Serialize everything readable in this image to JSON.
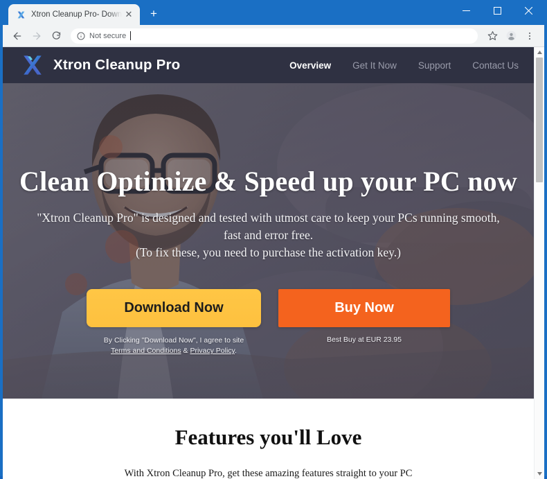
{
  "browser": {
    "tab": {
      "title": "Xtron Cleanup Pro- Download P",
      "favicon_name": "xtron-favicon",
      "close_label": "✕"
    },
    "newtab_label": "+",
    "window_controls": {
      "minimize": "minimize-button",
      "maximize": "maximize-button",
      "close": "close-button"
    },
    "toolbar": {
      "back": "back-button",
      "forward": "forward-button",
      "reload": "reload-button",
      "security_label": "Not secure",
      "url_value": "",
      "url_placeholder": "",
      "bookmark": "bookmark-star-button",
      "profile": "profile-button",
      "menu": "chrome-menu-button"
    }
  },
  "site": {
    "brand": "Xtron Cleanup Pro",
    "nav": [
      {
        "label": "Overview",
        "active": true
      },
      {
        "label": "Get It Now",
        "active": false
      },
      {
        "label": "Support",
        "active": false
      },
      {
        "label": "Contact Us",
        "active": false
      }
    ],
    "hero": {
      "title": "Clean Optimize & Speed up your PC now",
      "sub_line1": "\"Xtron Cleanup Pro\" is designed and tested with utmost care to keep your PCs running smooth,",
      "sub_line2": "fast and error free.",
      "sub_line3": "(To fix these, you need to purchase the activation key.)",
      "download_button": "Download Now",
      "buy_button": "Buy Now",
      "download_note_prefix": "By Clicking \"Download Now\", I agree to site",
      "terms_link": "Terms and Conditions",
      "note_amp": "&",
      "privacy_link": "Privacy Policy",
      "note_period": ".",
      "buy_note": "Best Buy at EUR 23.95"
    },
    "features": {
      "title": "Features you'll Love",
      "subtitle": "With Xtron Cleanup Pro, get these amazing features straight to your PC"
    }
  },
  "colors": {
    "window_frame": "#1a6fc4",
    "site_header": "#2f3142",
    "download_button": "#fdc13f",
    "buy_button": "#f4631e",
    "nav_active": "#ffffff",
    "nav_inactive": "#9a9cab"
  }
}
